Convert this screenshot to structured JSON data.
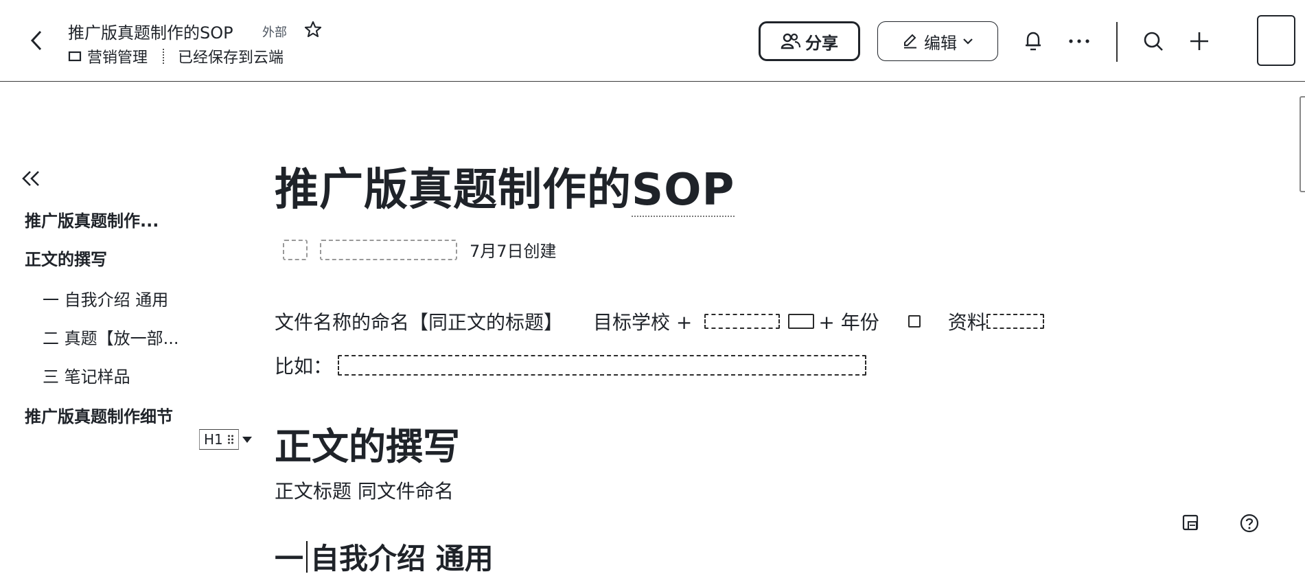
{
  "header": {
    "doc_title": "推广版真题制作的SOP",
    "external_tag": "外部",
    "folder_name": "营销管理",
    "save_status": "已经保存到云端",
    "share_label": "分享",
    "edit_label": "编辑"
  },
  "outline": {
    "items": [
      {
        "label": "推广版真题制作...",
        "level": 1
      },
      {
        "label": "正文的撰写",
        "level": 1
      },
      {
        "label": "一 自我介绍 通用",
        "level": 2
      },
      {
        "label": "二 真题【放一部...",
        "level": 2
      },
      {
        "label": "三 笔记样品",
        "level": 2
      },
      {
        "label": "推广版真题制作细节",
        "level": 1
      }
    ]
  },
  "document": {
    "title_main": "推广版真题制作的",
    "title_sop": "SOP",
    "created_label": "7月7日创建",
    "naming_rule_prefix": "文件名称的命名【同正文的标题】",
    "naming_rule_school": "目标学校 +",
    "naming_rule_year": "+ 年份",
    "naming_rule_material": "资料",
    "example_prefix": "比如：",
    "block_type": "H1",
    "heading_1": "正文的撰写",
    "body_text": "正文标题 同文件命名",
    "heading_2_prefix": "一",
    "heading_2_rest": "自我介绍 通用"
  },
  "icons": {
    "back": "chevron-left-icon",
    "star": "star-icon",
    "folder": "folder-icon",
    "share": "people-icon",
    "edit": "pencil-icon",
    "notification": "bell-icon",
    "more": "more-horizontal-icon",
    "search": "search-icon",
    "add": "plus-icon",
    "comment": "comment-icon",
    "help": "help-icon"
  }
}
